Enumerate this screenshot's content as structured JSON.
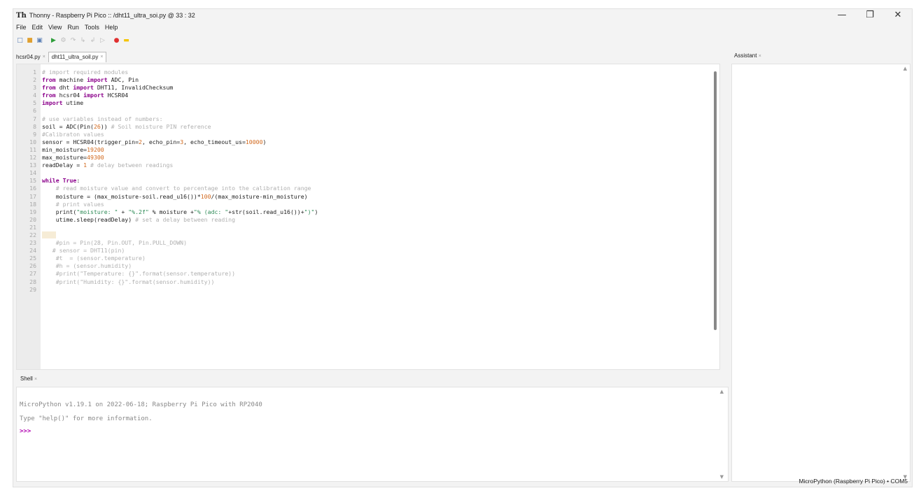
{
  "window": {
    "title": "Thonny  -  Raspberry Pi Pico :: /dht11_ultra_soi.py  @  33 : 32",
    "app_icon": "Th"
  },
  "window_controls": {
    "minimize": "—",
    "restore": "❐",
    "close": "✕"
  },
  "menu": [
    "File",
    "Edit",
    "View",
    "Run",
    "Tools",
    "Help"
  ],
  "toolbar": [
    {
      "name": "new-file-icon",
      "glyph": "□",
      "color": "#5a7fb5"
    },
    {
      "name": "open-file-icon",
      "glyph": "■",
      "color": "#e0a030"
    },
    {
      "name": "save-icon",
      "glyph": "▣",
      "color": "#5a7fb5"
    },
    {
      "name": "run-icon",
      "glyph": "▶",
      "color": "#2e9e3a"
    },
    {
      "name": "debug-icon",
      "glyph": "⚙",
      "color": "#bbbbbb"
    },
    {
      "name": "step-over-icon",
      "glyph": "↷",
      "color": "#bbbbbb"
    },
    {
      "name": "step-into-icon",
      "glyph": "↳",
      "color": "#bbbbbb"
    },
    {
      "name": "step-out-icon",
      "glyph": "↲",
      "color": "#bbbbbb"
    },
    {
      "name": "resume-icon",
      "glyph": "▷",
      "color": "#bbbbbb"
    },
    {
      "name": "stop-icon",
      "glyph": "●",
      "color": "#e03030"
    },
    {
      "name": "support-ukraine-icon",
      "glyph": "▬",
      "color": "#f5c400"
    }
  ],
  "editor_tabs": [
    {
      "label": "hcsr04.py",
      "active": false
    },
    {
      "label": "dht11_ultra_soil.py",
      "active": true
    }
  ],
  "code_lines": [
    [
      {
        "t": "# import required modules",
        "c": "#b0b0b0"
      }
    ],
    [
      {
        "t": "from",
        "c": "#8b008b",
        "b": true
      },
      {
        "t": " machine ",
        "c": "#222"
      },
      {
        "t": "import",
        "c": "#8b008b",
        "b": true
      },
      {
        "t": " ADC, Pin",
        "c": "#222"
      }
    ],
    [
      {
        "t": "from",
        "c": "#8b008b",
        "b": true
      },
      {
        "t": " dht ",
        "c": "#222"
      },
      {
        "t": "import",
        "c": "#8b008b",
        "b": true
      },
      {
        "t": " DHT11, InvalidChecksum",
        "c": "#222"
      }
    ],
    [
      {
        "t": "from",
        "c": "#8b008b",
        "b": true
      },
      {
        "t": " hcsr04 ",
        "c": "#222"
      },
      {
        "t": "import",
        "c": "#8b008b",
        "b": true
      },
      {
        "t": " HCSR04",
        "c": "#222"
      }
    ],
    [
      {
        "t": "import",
        "c": "#8b008b",
        "b": true
      },
      {
        "t": " utime",
        "c": "#222"
      }
    ],
    [],
    [
      {
        "t": "# use variables instead of numbers:",
        "c": "#b0b0b0"
      }
    ],
    [
      {
        "t": "soil = ADC(Pin(",
        "c": "#222"
      },
      {
        "t": "26",
        "c": "#d2691e"
      },
      {
        "t": ")) ",
        "c": "#222"
      },
      {
        "t": "# Soil moisture PIN reference",
        "c": "#b0b0b0"
      }
    ],
    [
      {
        "t": "#Calibraton values",
        "c": "#b0b0b0"
      }
    ],
    [
      {
        "t": "sensor = HCSR04(trigger_pin=",
        "c": "#222"
      },
      {
        "t": "2",
        "c": "#d2691e"
      },
      {
        "t": ", echo_pin=",
        "c": "#222"
      },
      {
        "t": "3",
        "c": "#d2691e"
      },
      {
        "t": ", echo_timeout_us=",
        "c": "#222"
      },
      {
        "t": "10000",
        "c": "#d2691e"
      },
      {
        "t": ")",
        "c": "#222"
      }
    ],
    [
      {
        "t": "min_moisture=",
        "c": "#222"
      },
      {
        "t": "19200",
        "c": "#d2691e"
      }
    ],
    [
      {
        "t": "max_moisture=",
        "c": "#222"
      },
      {
        "t": "49300",
        "c": "#d2691e"
      }
    ],
    [
      {
        "t": "readDelay = ",
        "c": "#222"
      },
      {
        "t": "1",
        "c": "#d2691e"
      },
      {
        "t": " # delay between readings",
        "c": "#b0b0b0"
      }
    ],
    [],
    [
      {
        "t": "while",
        "c": "#8b008b",
        "b": true
      },
      {
        "t": " ",
        "c": "#222"
      },
      {
        "t": "True",
        "c": "#8b008b",
        "b": true
      },
      {
        "t": ":",
        "c": "#222"
      }
    ],
    [
      {
        "t": "    # read moisture value and convert to percentage into the calibration range",
        "c": "#b0b0b0"
      }
    ],
    [
      {
        "t": "    moisture = (max_moisture-soil.read_u16())*",
        "c": "#222"
      },
      {
        "t": "100",
        "c": "#d2691e"
      },
      {
        "t": "/(max_moisture-min_moisture)",
        "c": "#222"
      }
    ],
    [
      {
        "t": "    # print values",
        "c": "#b0b0b0"
      }
    ],
    [
      {
        "t": "    print(",
        "c": "#222"
      },
      {
        "t": "\"moisture: \"",
        "c": "#2e8b57"
      },
      {
        "t": " + ",
        "c": "#222"
      },
      {
        "t": "\"%.2f\"",
        "c": "#2e8b57"
      },
      {
        "t": " % moisture +",
        "c": "#222"
      },
      {
        "t": "\"% (adc: \"",
        "c": "#2e8b57"
      },
      {
        "t": "+str(soil.read_u16())+",
        "c": "#222"
      },
      {
        "t": "\")\"",
        "c": "#2e8b57"
      },
      {
        "t": ")",
        "c": "#222"
      }
    ],
    [
      {
        "t": "    utime.sleep(readDelay) ",
        "c": "#222"
      },
      {
        "t": "# set a delay between reading",
        "c": "#b0b0b0"
      }
    ],
    [],
    [
      {
        "t": "    ",
        "c": "#222",
        "hl": true
      }
    ],
    [
      {
        "t": "    #pin = Pin(28, Pin.OUT, Pin.PULL_DOWN)",
        "c": "#b0b0b0"
      }
    ],
    [
      {
        "t": "   # sensor = DHT11(pin)",
        "c": "#b0b0b0"
      }
    ],
    [
      {
        "t": "    #t  = (sensor.temperature)",
        "c": "#b0b0b0"
      }
    ],
    [
      {
        "t": "    #h = (sensor.humidity)",
        "c": "#b0b0b0"
      }
    ],
    [
      {
        "t": "    #print(\"Temperature: {}\".format(sensor.temperature))",
        "c": "#b0b0b0"
      }
    ],
    [
      {
        "t": "    #print(\"Humidity: {}\".format(sensor.humidity))",
        "c": "#b0b0b0"
      }
    ],
    []
  ],
  "shell": {
    "tab_label": "Shell",
    "line1": "MicroPython v1.19.1 on 2022-06-18; Raspberry Pi Pico with RP2040",
    "line2": "Type \"help()\" for more information.",
    "prompt": ">>>"
  },
  "assistant": {
    "tab_label": "Assistant"
  },
  "status": {
    "interpreter": "MicroPython (Raspberry Pi Pico)  •  COM5"
  }
}
